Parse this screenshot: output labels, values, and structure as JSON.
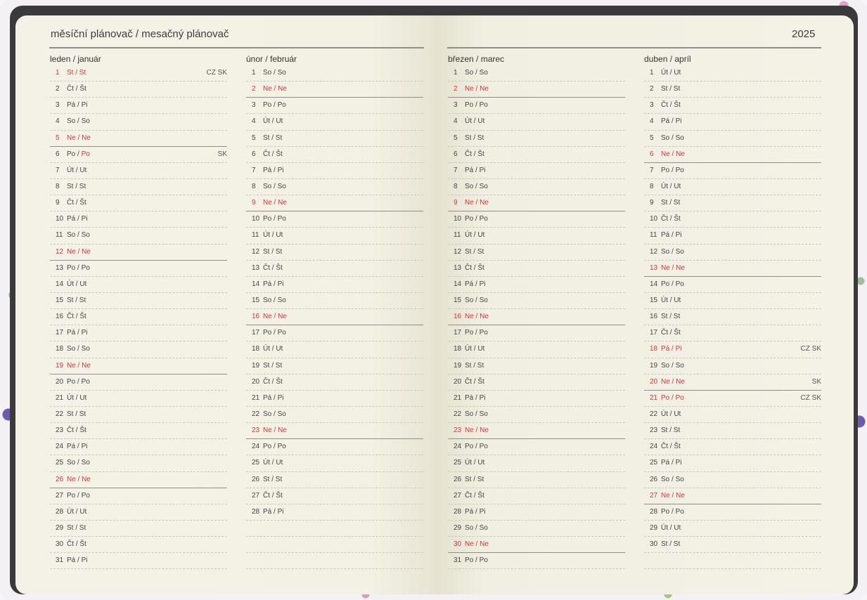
{
  "header": {
    "title": "měsíční plánovač / mesačný plánovač",
    "year": "2025"
  },
  "months": [
    {
      "name": "leden / január",
      "rows": 31,
      "days": [
        {
          "n": "1",
          "d": "St / St",
          "red": true,
          "hol": "CZ SK"
        },
        {
          "n": "2",
          "d": "Čt / Št"
        },
        {
          "n": "3",
          "d": "Pá / Pi"
        },
        {
          "n": "4",
          "d": "So / So"
        },
        {
          "n": "5",
          "d": "Ne / Ne",
          "red": true
        },
        {
          "n": "6",
          "d": "Po / Po",
          "redAlt": true,
          "hol": "SK"
        },
        {
          "n": "7",
          "d": "Út / Ut"
        },
        {
          "n": "8",
          "d": "St / St"
        },
        {
          "n": "9",
          "d": "Čt / Št"
        },
        {
          "n": "10",
          "d": "Pá / Pi"
        },
        {
          "n": "11",
          "d": "So / So"
        },
        {
          "n": "12",
          "d": "Ne / Ne",
          "red": true
        },
        {
          "n": "13",
          "d": "Po / Po"
        },
        {
          "n": "14",
          "d": "Út / Ut"
        },
        {
          "n": "15",
          "d": "St / St"
        },
        {
          "n": "16",
          "d": "Čt / Št"
        },
        {
          "n": "17",
          "d": "Pá / Pi"
        },
        {
          "n": "18",
          "d": "So / So"
        },
        {
          "n": "19",
          "d": "Ne / Ne",
          "red": true
        },
        {
          "n": "20",
          "d": "Po / Po"
        },
        {
          "n": "21",
          "d": "Út / Ut"
        },
        {
          "n": "22",
          "d": "St / St"
        },
        {
          "n": "23",
          "d": "Čt / Št"
        },
        {
          "n": "24",
          "d": "Pá / Pi"
        },
        {
          "n": "25",
          "d": "So / So"
        },
        {
          "n": "26",
          "d": "Ne / Ne",
          "red": true
        },
        {
          "n": "27",
          "d": "Po / Po"
        },
        {
          "n": "28",
          "d": "Út / Ut"
        },
        {
          "n": "29",
          "d": "St / St"
        },
        {
          "n": "30",
          "d": "Čt / Št"
        },
        {
          "n": "31",
          "d": "Pá / Pi"
        }
      ]
    },
    {
      "name": "únor / február",
      "rows": 31,
      "days": [
        {
          "n": "1",
          "d": "So / So"
        },
        {
          "n": "2",
          "d": "Ne / Ne",
          "red": true
        },
        {
          "n": "3",
          "d": "Po / Po"
        },
        {
          "n": "4",
          "d": "Út / Ut"
        },
        {
          "n": "5",
          "d": "St / St"
        },
        {
          "n": "6",
          "d": "Čt / Št"
        },
        {
          "n": "7",
          "d": "Pá / Pi"
        },
        {
          "n": "8",
          "d": "So / So"
        },
        {
          "n": "9",
          "d": "Ne / Ne",
          "red": true
        },
        {
          "n": "10",
          "d": "Po / Po"
        },
        {
          "n": "11",
          "d": "Út / Ut"
        },
        {
          "n": "12",
          "d": "St / St"
        },
        {
          "n": "13",
          "d": "Čt / Št"
        },
        {
          "n": "14",
          "d": "Pá / Pi"
        },
        {
          "n": "15",
          "d": "So / So"
        },
        {
          "n": "16",
          "d": "Ne / Ne",
          "red": true
        },
        {
          "n": "17",
          "d": "Po / Po"
        },
        {
          "n": "18",
          "d": "Út / Ut"
        },
        {
          "n": "19",
          "d": "St / St"
        },
        {
          "n": "20",
          "d": "Čt / Št"
        },
        {
          "n": "21",
          "d": "Pá / Pi"
        },
        {
          "n": "22",
          "d": "So / So"
        },
        {
          "n": "23",
          "d": "Ne / Ne",
          "red": true
        },
        {
          "n": "24",
          "d": "Po / Po"
        },
        {
          "n": "25",
          "d": "Út / Ut"
        },
        {
          "n": "26",
          "d": "St / St"
        },
        {
          "n": "27",
          "d": "Čt / Št"
        },
        {
          "n": "28",
          "d": "Pá / Pi"
        }
      ]
    },
    {
      "name": "březen / marec",
      "rows": 31,
      "days": [
        {
          "n": "1",
          "d": "So / So"
        },
        {
          "n": "2",
          "d": "Ne / Ne",
          "red": true
        },
        {
          "n": "3",
          "d": "Po / Po"
        },
        {
          "n": "4",
          "d": "Út / Ut"
        },
        {
          "n": "5",
          "d": "St / St"
        },
        {
          "n": "6",
          "d": "Čt / Št"
        },
        {
          "n": "7",
          "d": "Pá / Pi"
        },
        {
          "n": "8",
          "d": "So / So"
        },
        {
          "n": "9",
          "d": "Ne / Ne",
          "red": true
        },
        {
          "n": "10",
          "d": "Po / Po"
        },
        {
          "n": "11",
          "d": "Út / Ut"
        },
        {
          "n": "12",
          "d": "St / St"
        },
        {
          "n": "13",
          "d": "Čt / Št"
        },
        {
          "n": "14",
          "d": "Pá / Pi"
        },
        {
          "n": "15",
          "d": "So / So"
        },
        {
          "n": "16",
          "d": "Ne / Ne",
          "red": true
        },
        {
          "n": "17",
          "d": "Po / Po"
        },
        {
          "n": "18",
          "d": "Út / Ut"
        },
        {
          "n": "19",
          "d": "St / St"
        },
        {
          "n": "20",
          "d": "Čt / Št"
        },
        {
          "n": "21",
          "d": "Pá / Pi"
        },
        {
          "n": "22",
          "d": "So / So"
        },
        {
          "n": "23",
          "d": "Ne / Ne",
          "red": true
        },
        {
          "n": "24",
          "d": "Po / Po"
        },
        {
          "n": "25",
          "d": "Út / Ut"
        },
        {
          "n": "26",
          "d": "St / St"
        },
        {
          "n": "27",
          "d": "Čt / Št"
        },
        {
          "n": "28",
          "d": "Pá / Pi"
        },
        {
          "n": "29",
          "d": "So / So"
        },
        {
          "n": "30",
          "d": "Ne / Ne",
          "red": true
        },
        {
          "n": "31",
          "d": "Po / Po"
        }
      ]
    },
    {
      "name": "duben / apríl",
      "rows": 31,
      "days": [
        {
          "n": "1",
          "d": "Út / Ut"
        },
        {
          "n": "2",
          "d": "St / St"
        },
        {
          "n": "3",
          "d": "Čt / Št"
        },
        {
          "n": "4",
          "d": "Pá / Pi"
        },
        {
          "n": "5",
          "d": "So / So"
        },
        {
          "n": "6",
          "d": "Ne / Ne",
          "red": true
        },
        {
          "n": "7",
          "d": "Po / Po"
        },
        {
          "n": "8",
          "d": "Út / Ut"
        },
        {
          "n": "9",
          "d": "St / St"
        },
        {
          "n": "10",
          "d": "Čt / Št"
        },
        {
          "n": "11",
          "d": "Pá / Pi"
        },
        {
          "n": "12",
          "d": "So / So"
        },
        {
          "n": "13",
          "d": "Ne / Ne",
          "red": true
        },
        {
          "n": "14",
          "d": "Po / Po"
        },
        {
          "n": "15",
          "d": "Út / Ut"
        },
        {
          "n": "16",
          "d": "St / St"
        },
        {
          "n": "17",
          "d": "Čt / Št"
        },
        {
          "n": "18",
          "d": "Pá / Pi",
          "red": true,
          "hol": "CZ SK"
        },
        {
          "n": "19",
          "d": "So / So"
        },
        {
          "n": "20",
          "d": "Ne / Ne",
          "red": true,
          "hol": "SK"
        },
        {
          "n": "21",
          "d": "Po / Po",
          "red": true,
          "hol": "CZ SK"
        },
        {
          "n": "22",
          "d": "Út / Ut"
        },
        {
          "n": "23",
          "d": "St / St"
        },
        {
          "n": "24",
          "d": "Čt / Št"
        },
        {
          "n": "25",
          "d": "Pá / Pi"
        },
        {
          "n": "26",
          "d": "So / So"
        },
        {
          "n": "27",
          "d": "Ne / Ne",
          "red": true
        },
        {
          "n": "28",
          "d": "Po / Po"
        },
        {
          "n": "29",
          "d": "Út / Ut"
        },
        {
          "n": "30",
          "d": "St / St"
        }
      ]
    }
  ],
  "colors": {
    "holiday": "#d9343a",
    "rule": "#8f8e88",
    "paper": "#f3f1e4"
  }
}
